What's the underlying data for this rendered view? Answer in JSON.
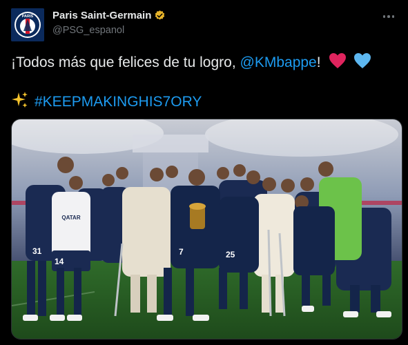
{
  "author": {
    "display_name": "Paris Saint-Germain",
    "handle": "@PSG_espanol",
    "avatar_text": "PARIS",
    "verified_icon": "verified-badge-icon",
    "verified_color": "#e8b42a"
  },
  "more_icon": "more-options-icon",
  "tweet": {
    "text_before": "¡Todos más que felices de tu logro, ",
    "mention": "@KMbappe",
    "text_after": "!",
    "hashtag": "#KEEPMAKINGHIS7ORY",
    "emoji": [
      "red-heart-icon",
      "blue-heart-icon",
      "sparkles-icon"
    ]
  },
  "photo": {
    "jersey_numbers": [
      "31",
      "14",
      "7",
      "25"
    ],
    "sponsor_text": "QATAR"
  },
  "colors": {
    "background": "#000000",
    "text": "#e7e9ea",
    "secondary": "#71767b",
    "link": "#1d9bf0",
    "psg_navy": "#14254a",
    "goalkeeper_green": "#6cc24a"
  }
}
